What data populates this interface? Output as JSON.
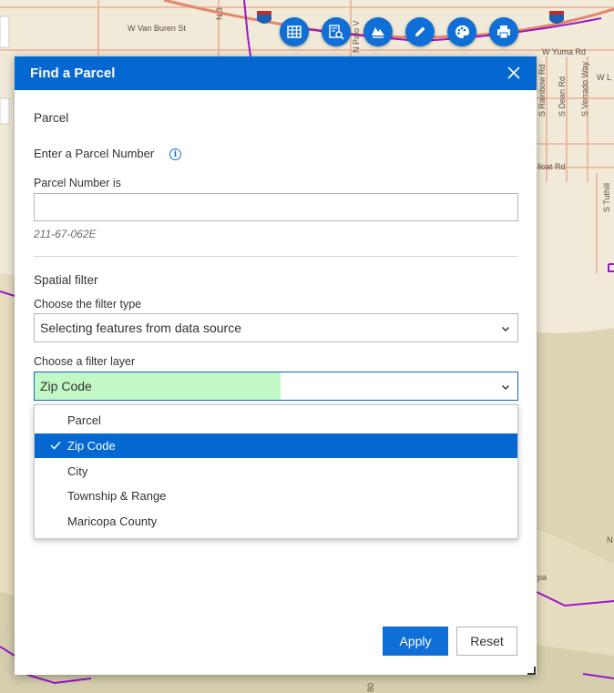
{
  "map": {
    "labels": [
      "W Van Buren St",
      "W Yuma Rd",
      "S Rainbow Rd",
      "S Dean Rd",
      "S Verrado Way",
      "lloat Rd",
      "S Tuthill",
      "N Palo V",
      "N 3",
      "W L",
      "N",
      "pa",
      "80"
    ],
    "road_color": "#e9a38a",
    "boundary_color": "#9a16c9"
  },
  "toolbar": {
    "buttons": [
      "table-icon",
      "query-icon",
      "basemap-icon",
      "edit-icon",
      "style-icon",
      "print-icon"
    ],
    "color": "#0f6fd6"
  },
  "panel": {
    "title": "Find a Parcel",
    "section_title": "Parcel",
    "parcel_prompt": "Enter a Parcel Number",
    "parcel_field_label": "Parcel Number is",
    "parcel_value": "",
    "parcel_hint": "211-67-062E",
    "spatial_title": "Spatial filter",
    "filter_type_label": "Choose the filter type",
    "filter_type_value": "Selecting features from data source",
    "filter_layer_label": "Choose a filter layer",
    "filter_layer_value": "Zip Code",
    "filter_layer_options": [
      "Parcel",
      "Zip Code",
      "City",
      "Township & Range",
      "Maricopa County"
    ],
    "selected_option": "Zip Code",
    "apply_label": "Apply",
    "reset_label": "Reset",
    "accent_color": "#0568d1",
    "highlight_color": "#c2f8c5"
  }
}
